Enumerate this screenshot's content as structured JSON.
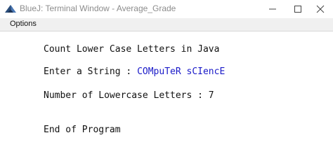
{
  "window": {
    "title": "BlueJ: Terminal Window - Average_Grade",
    "minimize_glyph": "—",
    "maximize_glyph": "☐",
    "close_glyph": "✕"
  },
  "menu": {
    "items": [
      {
        "label": "Options"
      }
    ]
  },
  "console": {
    "line1": "Count Lower Case Letters in Java",
    "line2_prompt": "Enter a String : ",
    "line2_input": "COMpuTeR sCIencE",
    "line3": "Number of Lowercase Letters : 7",
    "line4": "End of Program"
  },
  "colors": {
    "input_text": "#1a1ac8",
    "title_text": "#8c8c8c",
    "menu_background": "#f0f0f0"
  },
  "icons": {
    "app": "bluej-app-icon"
  }
}
